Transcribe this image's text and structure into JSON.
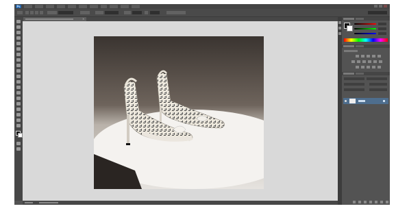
{
  "app": {
    "logo_text": "Ps",
    "menu_labels": [
      "",
      "",
      "",
      "",
      "",
      "",
      "",
      "",
      "",
      "",
      ""
    ],
    "window_controls": [
      "minimize-icon",
      "restore-icon",
      "close-icon"
    ]
  },
  "document_tab": {
    "title": "",
    "close_glyph": "×"
  },
  "toolbar": {
    "tools": [
      "move-tool-icon",
      "marquee-tool-icon",
      "lasso-tool-icon",
      "quick-select-tool-icon",
      "crop-tool-icon",
      "eyedropper-tool-icon",
      "healing-brush-tool-icon",
      "brush-tool-icon",
      "clone-stamp-tool-icon",
      "history-brush-tool-icon",
      "eraser-tool-icon",
      "gradient-tool-icon",
      "blur-tool-icon",
      "dodge-tool-icon",
      "pen-tool-icon",
      "type-tool-icon",
      "path-select-tool-icon",
      "shape-tool-icon",
      "hand-tool-icon",
      "zoom-tool-icon"
    ],
    "foreground_color": "#111111",
    "background_color": "#ffffff"
  },
  "colors": {
    "ui_dark": "#535353",
    "workspace": "#d9d9d9",
    "selected_layer": "#4e6e8e"
  },
  "status": {
    "zoom": "",
    "doc_info": ""
  },
  "layers": {
    "items": [
      {
        "name": ""
      }
    ]
  }
}
